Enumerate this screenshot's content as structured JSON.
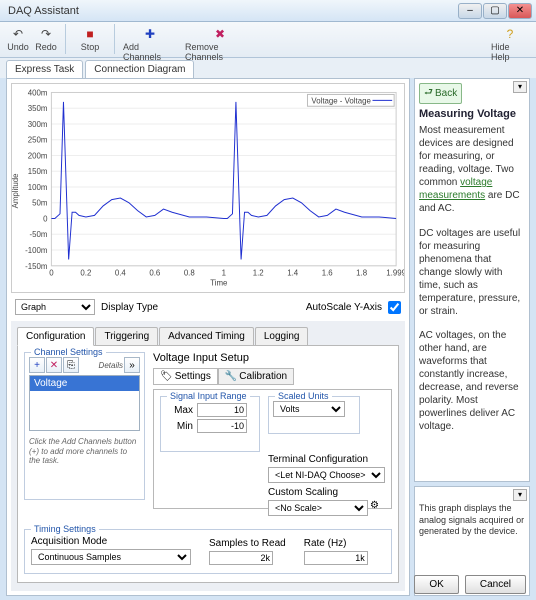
{
  "window": {
    "title": "DAQ Assistant"
  },
  "toolbar": {
    "undo": "Undo",
    "redo": "Redo",
    "stop": "Stop",
    "add": "Add Channels",
    "remove": "Remove Channels",
    "hidehelp": "Hide Help"
  },
  "tabs": {
    "express": "Express Task",
    "conn": "Connection Diagram"
  },
  "graph": {
    "ylabel": "Amplitude",
    "xlabel": "Time",
    "legend": "Voltage - Voltage",
    "display_type_label": "Display Type",
    "display_type": "Graph",
    "autoscale_label": "AutoScale Y-Axis",
    "y_ticks": [
      "400m",
      "350m",
      "300m",
      "250m",
      "200m",
      "150m",
      "100m",
      "50m",
      "0",
      "-50m",
      "-100m",
      "-150m"
    ],
    "x_ticks": [
      "0",
      "0.2",
      "0.4",
      "0.6",
      "0.8",
      "1",
      "1.2",
      "1.4",
      "1.6",
      "1.8",
      "1.999"
    ]
  },
  "chart_data": {
    "type": "line",
    "series": [
      {
        "name": "Voltage - Voltage",
        "x": [
          0,
          0.02,
          0.05,
          0.07,
          0.1,
          0.12,
          0.14,
          0.16,
          0.2,
          0.25,
          0.3,
          0.35,
          0.4,
          0.45,
          0.5,
          0.55,
          0.6,
          0.65,
          0.7,
          0.8,
          0.9,
          1.0,
          1.02,
          1.05,
          1.07,
          1.1,
          1.12,
          1.14,
          1.16,
          1.2,
          1.25,
          1.3,
          1.35,
          1.4,
          1.45,
          1.5,
          1.55,
          1.6,
          1.65,
          1.7,
          1.8,
          1.9,
          1.999
        ],
        "y": [
          0,
          0,
          0.015,
          0.37,
          -0.13,
          0.02,
          0.02,
          0.01,
          0.005,
          0.01,
          0.04,
          0.06,
          0.065,
          0.05,
          0.025,
          0.005,
          0.01,
          0.03,
          0.02,
          0.005,
          0.005,
          0,
          0,
          0.015,
          0.37,
          -0.13,
          0.02,
          0.02,
          0.01,
          0.005,
          0.01,
          0.04,
          0.06,
          0.065,
          0.05,
          0.025,
          0.005,
          0.01,
          0.03,
          0.02,
          0.005,
          0.005,
          0
        ]
      }
    ],
    "xlabel": "Time",
    "ylabel": "Amplitude",
    "xlim": [
      0,
      1.999
    ],
    "ylim": [
      -0.15,
      0.4
    ]
  },
  "cfg": {
    "tabs": [
      "Configuration",
      "Triggering",
      "Advanced Timing",
      "Logging"
    ],
    "channel_settings": "Channel Settings",
    "details": "Details",
    "channel_selected": "Voltage",
    "hint": "Click the Add Channels button (+) to add more channels to the task.",
    "voltage_setup": "Voltage Input Setup",
    "subtabs": {
      "settings": "Settings",
      "calib": "Calibration"
    },
    "range_box": "Signal Input Range",
    "max_label": "Max",
    "min_label": "Min",
    "max": "10",
    "min": "-10",
    "scaled_units": "Scaled Units",
    "units": "Volts",
    "term_label": "Terminal Configuration",
    "term_value": "<Let NI-DAQ Choose>",
    "scale_label": "Custom Scaling",
    "scale_value": "<No Scale>"
  },
  "timing": {
    "legend": "Timing Settings",
    "mode_label": "Acquisition Mode",
    "mode": "Continuous Samples",
    "samples_label": "Samples to Read",
    "samples": "2k",
    "rate_label": "Rate (Hz)",
    "rate": "1k"
  },
  "help": {
    "back": "Back",
    "title": "Measuring Voltage",
    "p1": "Most measurement devices are designed for measuring, or reading, voltage. Two common ",
    "link": "voltage measurements",
    "p1b": " are DC and AC.",
    "p2": "DC voltages are useful for measuring phenomena that change slowly with time, such as temperature, pressure, or strain.",
    "p3": "AC voltages, on the other hand, are waveforms that constantly increase, decrease, and reverse polarity. Most powerlines deliver AC voltage.",
    "note": "This graph displays the analog signals acquired or generated by the device."
  },
  "buttons": {
    "ok": "OK",
    "cancel": "Cancel"
  }
}
